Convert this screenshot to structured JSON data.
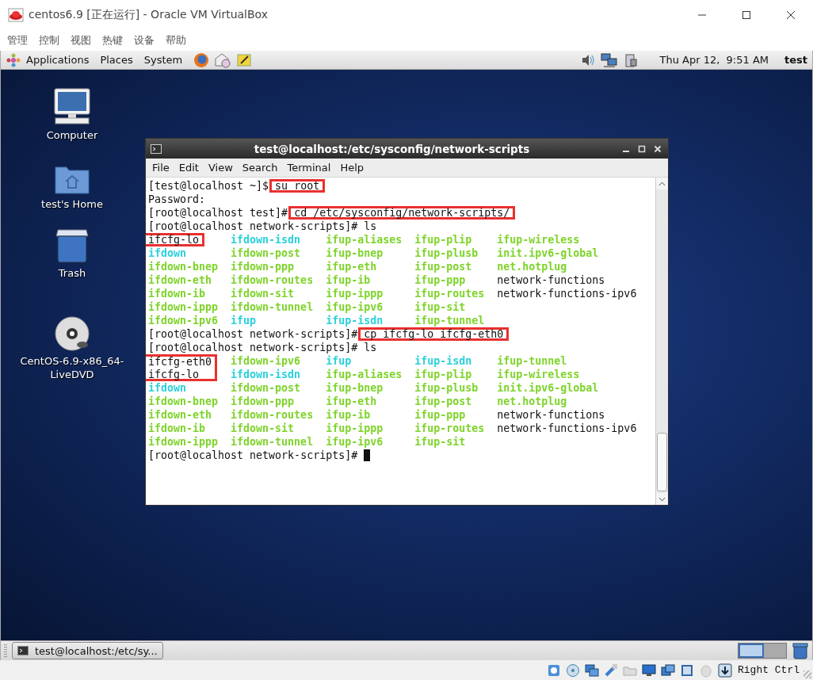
{
  "window": {
    "title": "centos6.9 [正在运行] - Oracle VM VirtualBox"
  },
  "vbox_menu": [
    "管理",
    "控制",
    "视图",
    "热键",
    "设备",
    "帮助"
  ],
  "top_panel": {
    "menus": [
      "Applications",
      "Places",
      "System"
    ],
    "clock": "Thu Apr 12,  9:51 AM",
    "user": "test"
  },
  "desktop_icons": [
    {
      "label": "Computer",
      "kind": "computer"
    },
    {
      "label": "test's Home",
      "kind": "home"
    },
    {
      "label": "Trash",
      "kind": "trash"
    },
    {
      "label": "CentOS-6.9-x86_64-LiveDVD",
      "kind": "disc"
    }
  ],
  "terminal": {
    "title": "test@localhost:/etc/sysconfig/network-scripts",
    "menu": [
      "File",
      "Edit",
      "View",
      "Search",
      "Terminal",
      "Help"
    ],
    "lines": [
      {
        "kind": "prompt",
        "prompt": "[test@localhost ~]$",
        "command": "su root",
        "highlighted": true,
        "cursor": false
      },
      {
        "kind": "output",
        "text": "Password:"
      },
      {
        "kind": "prompt",
        "prompt": "[root@localhost test]#",
        "command": "cd /etc/sysconfig/network-scripts/",
        "highlighted": true,
        "cursor": false
      },
      {
        "kind": "prompt",
        "prompt": "[root@localhost network-scripts]#",
        "command": "ls",
        "highlighted": false,
        "cursor": false
      },
      {
        "kind": "listing",
        "columns": [
          [
            {
              "name": "ifcfg-lo",
              "kind": "file",
              "highlighted": true
            },
            {
              "name": "ifdown",
              "kind": "link",
              "highlighted": false
            },
            {
              "name": "ifdown-bnep",
              "kind": "exec",
              "highlighted": false
            },
            {
              "name": "ifdown-eth",
              "kind": "exec",
              "highlighted": false
            },
            {
              "name": "ifdown-ib",
              "kind": "exec",
              "highlighted": false
            },
            {
              "name": "ifdown-ippp",
              "kind": "exec",
              "highlighted": false
            },
            {
              "name": "ifdown-ipv6",
              "kind": "exec",
              "highlighted": false
            }
          ],
          [
            {
              "name": "ifdown-isdn",
              "kind": "link",
              "highlighted": false
            },
            {
              "name": "ifdown-post",
              "kind": "exec",
              "highlighted": false
            },
            {
              "name": "ifdown-ppp",
              "kind": "exec",
              "highlighted": false
            },
            {
              "name": "ifdown-routes",
              "kind": "exec",
              "highlighted": false
            },
            {
              "name": "ifdown-sit",
              "kind": "exec",
              "highlighted": false
            },
            {
              "name": "ifdown-tunnel",
              "kind": "exec",
              "highlighted": false
            },
            {
              "name": "ifup",
              "kind": "link",
              "highlighted": false
            }
          ],
          [
            {
              "name": "ifup-aliases",
              "kind": "exec",
              "highlighted": false
            },
            {
              "name": "ifup-bnep",
              "kind": "exec",
              "highlighted": false
            },
            {
              "name": "ifup-eth",
              "kind": "exec",
              "highlighted": false
            },
            {
              "name": "ifup-ib",
              "kind": "exec",
              "highlighted": false
            },
            {
              "name": "ifup-ippp",
              "kind": "exec",
              "highlighted": false
            },
            {
              "name": "ifup-ipv6",
              "kind": "exec",
              "highlighted": false
            },
            {
              "name": "ifup-isdn",
              "kind": "link",
              "highlighted": false
            }
          ],
          [
            {
              "name": "ifup-plip",
              "kind": "exec",
              "highlighted": false
            },
            {
              "name": "ifup-plusb",
              "kind": "exec",
              "highlighted": false
            },
            {
              "name": "ifup-post",
              "kind": "exec",
              "highlighted": false
            },
            {
              "name": "ifup-ppp",
              "kind": "exec",
              "highlighted": false
            },
            {
              "name": "ifup-routes",
              "kind": "exec",
              "highlighted": false
            },
            {
              "name": "ifup-sit",
              "kind": "exec",
              "highlighted": false
            },
            {
              "name": "ifup-tunnel",
              "kind": "exec",
              "highlighted": false
            }
          ],
          [
            {
              "name": "ifup-wireless",
              "kind": "exec",
              "highlighted": false
            },
            {
              "name": "init.ipv6-global",
              "kind": "exec",
              "highlighted": false
            },
            {
              "name": "net.hotplug",
              "kind": "exec",
              "highlighted": false
            },
            {
              "name": "network-functions",
              "kind": "file",
              "highlighted": false
            },
            {
              "name": "network-functions-ipv6",
              "kind": "file",
              "highlighted": false
            }
          ]
        ]
      },
      {
        "kind": "prompt",
        "prompt": "[root@localhost network-scripts]#",
        "command": "cp ifcfg-lo ifcfg-eth0",
        "highlighted": true,
        "cursor": false
      },
      {
        "kind": "prompt",
        "prompt": "[root@localhost network-scripts]#",
        "command": "ls",
        "highlighted": false,
        "cursor": false
      },
      {
        "kind": "listing",
        "columns": [
          [
            {
              "name": "ifcfg-eth0",
              "kind": "file",
              "highlighted": true
            },
            {
              "name": "ifcfg-lo",
              "kind": "file",
              "highlighted": true
            },
            {
              "name": "ifdown",
              "kind": "link",
              "highlighted": false
            },
            {
              "name": "ifdown-bnep",
              "kind": "exec",
              "highlighted": false
            },
            {
              "name": "ifdown-eth",
              "kind": "exec",
              "highlighted": false
            },
            {
              "name": "ifdown-ib",
              "kind": "exec",
              "highlighted": false
            },
            {
              "name": "ifdown-ippp",
              "kind": "exec",
              "highlighted": false
            }
          ],
          [
            {
              "name": "ifdown-ipv6",
              "kind": "exec",
              "highlighted": false
            },
            {
              "name": "ifdown-isdn",
              "kind": "link",
              "highlighted": false
            },
            {
              "name": "ifdown-post",
              "kind": "exec",
              "highlighted": false
            },
            {
              "name": "ifdown-ppp",
              "kind": "exec",
              "highlighted": false
            },
            {
              "name": "ifdown-routes",
              "kind": "exec",
              "highlighted": false
            },
            {
              "name": "ifdown-sit",
              "kind": "exec",
              "highlighted": false
            },
            {
              "name": "ifdown-tunnel",
              "kind": "exec",
              "highlighted": false
            }
          ],
          [
            {
              "name": "ifup",
              "kind": "link",
              "highlighted": false
            },
            {
              "name": "ifup-aliases",
              "kind": "exec",
              "highlighted": false
            },
            {
              "name": "ifup-bnep",
              "kind": "exec",
              "highlighted": false
            },
            {
              "name": "ifup-eth",
              "kind": "exec",
              "highlighted": false
            },
            {
              "name": "ifup-ib",
              "kind": "exec",
              "highlighted": false
            },
            {
              "name": "ifup-ippp",
              "kind": "exec",
              "highlighted": false
            },
            {
              "name": "ifup-ipv6",
              "kind": "exec",
              "highlighted": false
            }
          ],
          [
            {
              "name": "ifup-isdn",
              "kind": "link",
              "highlighted": false
            },
            {
              "name": "ifup-plip",
              "kind": "exec",
              "highlighted": false
            },
            {
              "name": "ifup-plusb",
              "kind": "exec",
              "highlighted": false
            },
            {
              "name": "ifup-post",
              "kind": "exec",
              "highlighted": false
            },
            {
              "name": "ifup-ppp",
              "kind": "exec",
              "highlighted": false
            },
            {
              "name": "ifup-routes",
              "kind": "exec",
              "highlighted": false
            },
            {
              "name": "ifup-sit",
              "kind": "exec",
              "highlighted": false
            }
          ],
          [
            {
              "name": "ifup-tunnel",
              "kind": "exec",
              "highlighted": false
            },
            {
              "name": "ifup-wireless",
              "kind": "exec",
              "highlighted": false
            },
            {
              "name": "init.ipv6-global",
              "kind": "exec",
              "highlighted": false
            },
            {
              "name": "net.hotplug",
              "kind": "exec",
              "highlighted": false
            },
            {
              "name": "network-functions",
              "kind": "file",
              "highlighted": false
            },
            {
              "name": "network-functions-ipv6",
              "kind": "file",
              "highlighted": false
            }
          ]
        ]
      },
      {
        "kind": "prompt",
        "prompt": "[root@localhost network-scripts]#",
        "cursor": true
      }
    ]
  },
  "taskbar": {
    "items": [
      {
        "label": "test@localhost:/etc/sy..."
      }
    ]
  },
  "status_bar": {
    "host_key": "Right Ctrl"
  }
}
